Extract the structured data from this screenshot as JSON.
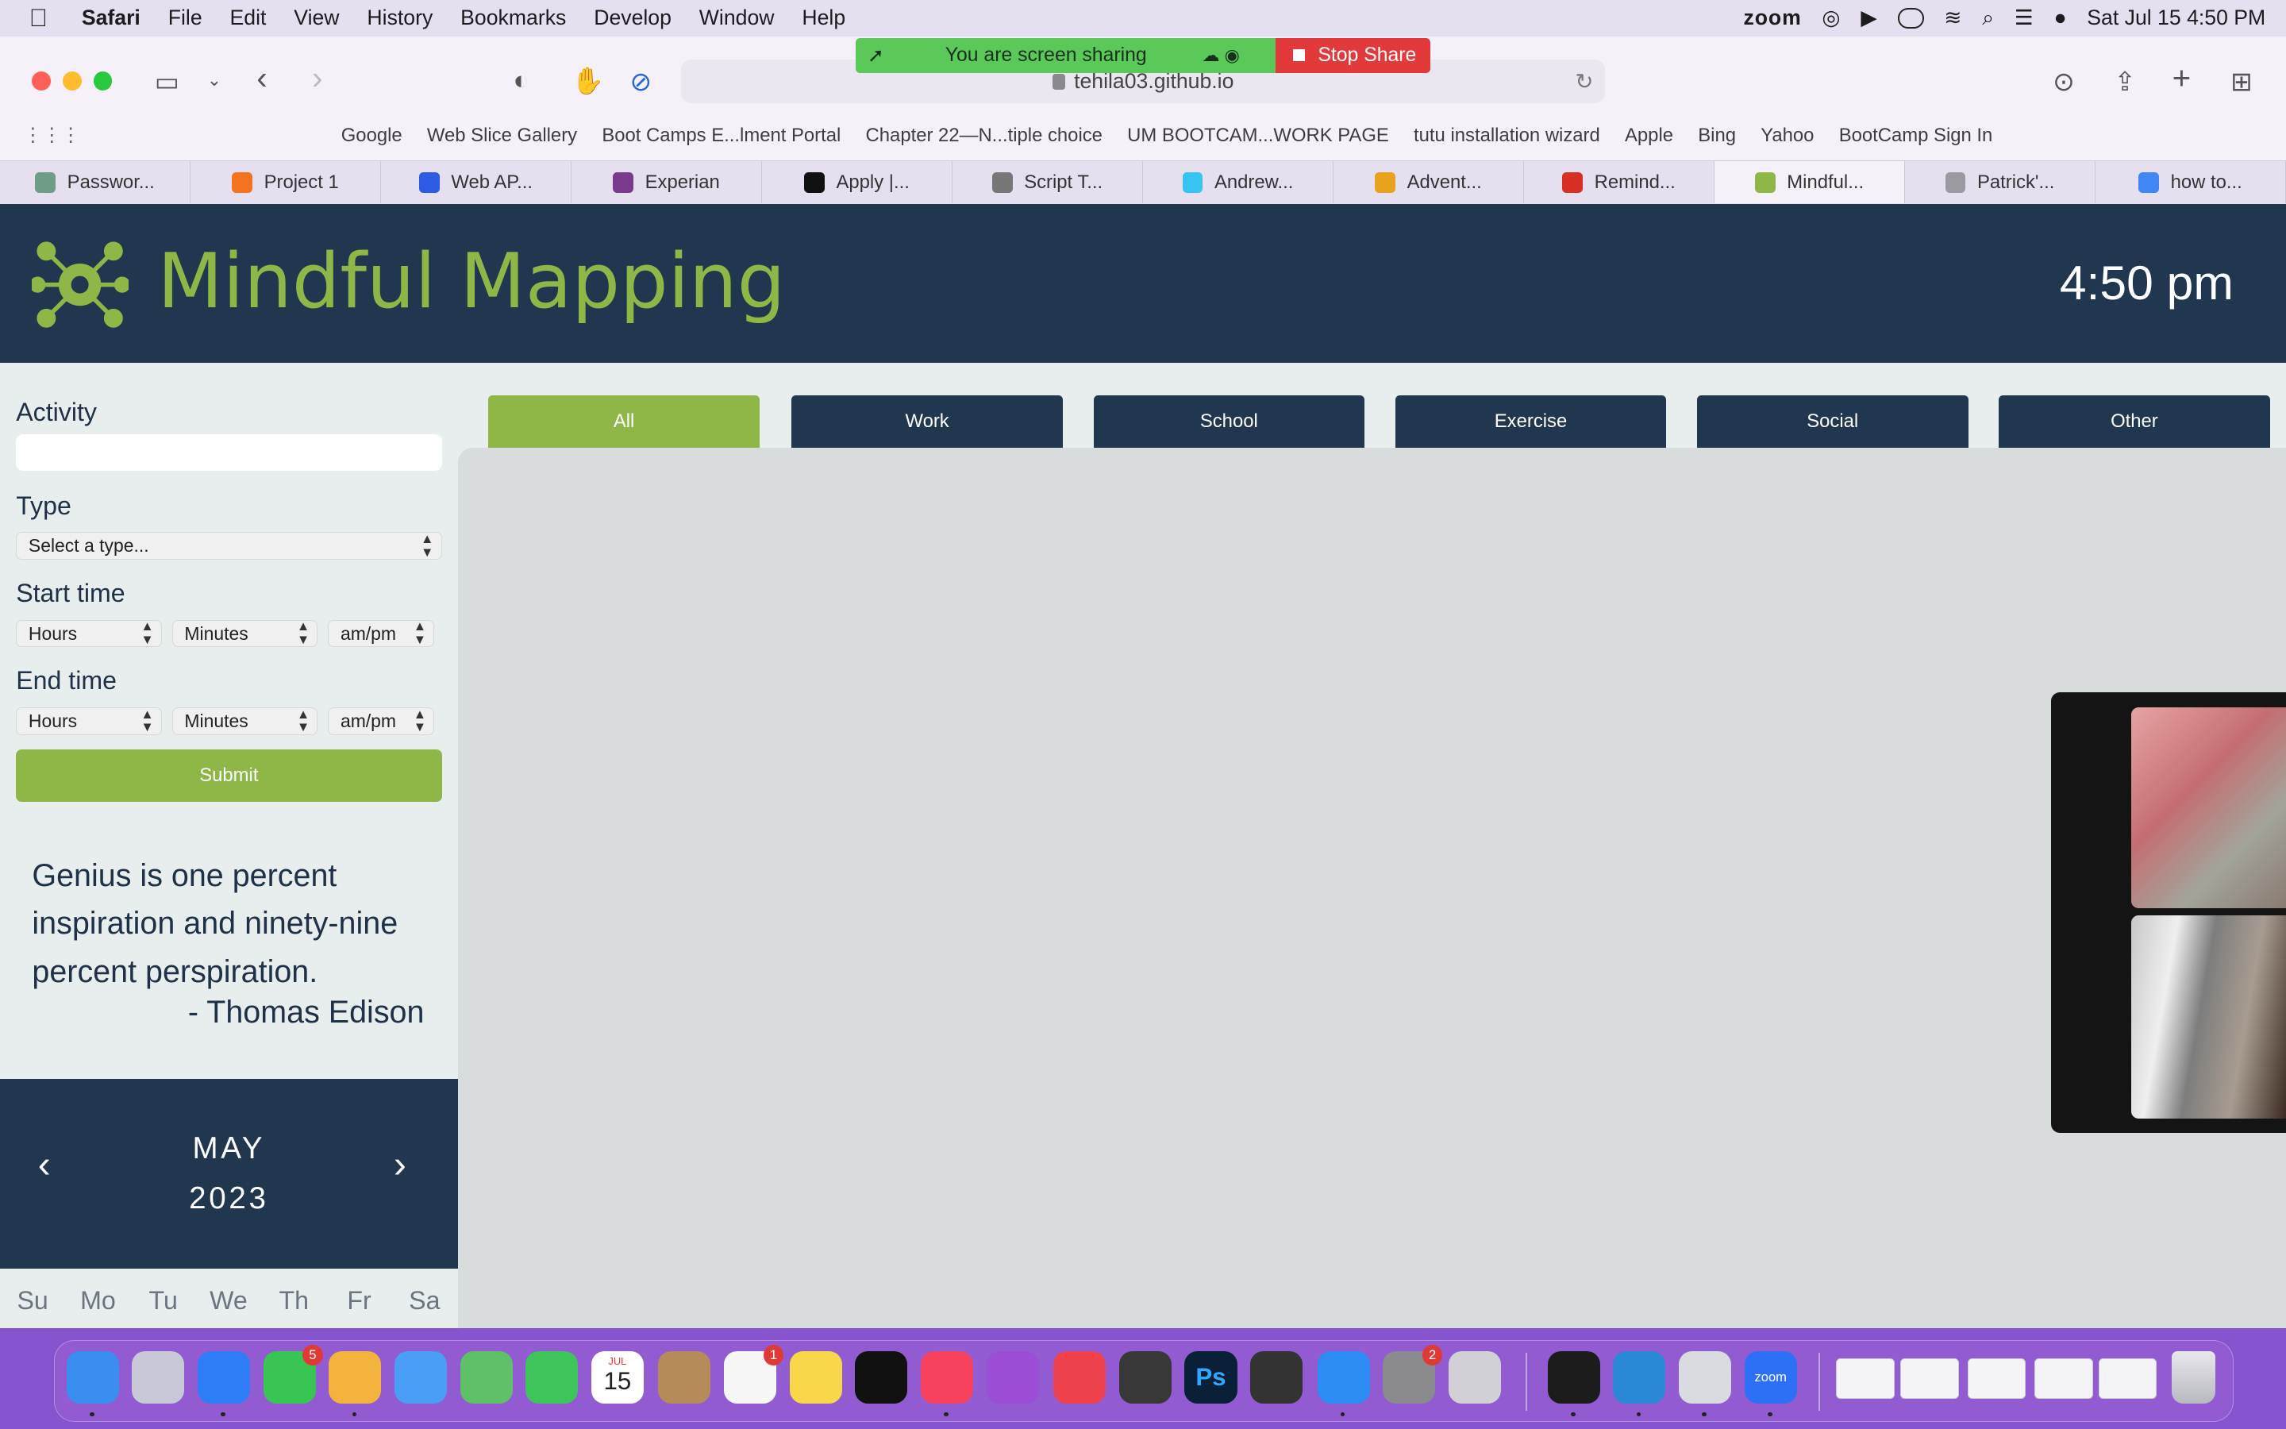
{
  "menubar": {
    "app": "Safari",
    "items": [
      "File",
      "Edit",
      "View",
      "History",
      "Bookmarks",
      "Develop",
      "Window",
      "Help"
    ],
    "zoom": "zoom",
    "datetime": "Sat Jul 15  4:50 PM"
  },
  "share": {
    "status": "You are screen sharing",
    "stop": "Stop Share"
  },
  "browser": {
    "url": "tehila03.github.io",
    "bookmarks": [
      "Google",
      "Web Slice Gallery",
      "Boot Camps E...lment Portal",
      "Chapter 22—N...tiple choice",
      "UM BOOTCAM...WORK PAGE",
      "tutu installation wizard",
      "Apple",
      "Bing",
      "Yahoo",
      "BootCamp Sign In"
    ],
    "tabs": [
      {
        "label": "Passwor...",
        "color": "#6f9d88"
      },
      {
        "label": "Project 1",
        "color": "#f47321"
      },
      {
        "label": "Web AP...",
        "color": "#2d5be3"
      },
      {
        "label": "Experian",
        "color": "#7b3b8c"
      },
      {
        "label": "Apply |...",
        "color": "#111111"
      },
      {
        "label": "Script T...",
        "color": "#777777"
      },
      {
        "label": "Andrew...",
        "color": "#36c5f0"
      },
      {
        "label": "Advent...",
        "color": "#e8a21d"
      },
      {
        "label": "Remind...",
        "color": "#d93025"
      },
      {
        "label": "Mindful...",
        "color": "#8eb748"
      },
      {
        "label": "Patrick'...",
        "color": "#9a9aa0"
      },
      {
        "label": "how to...",
        "color": "#4285f4"
      }
    ]
  },
  "app": {
    "title": "Mindful Mapping",
    "time": "4:50 pm",
    "form": {
      "activity_label": "Activity",
      "type_label": "Type",
      "type_select": "Select a type...",
      "start_label": "Start time",
      "end_label": "End time",
      "hours": "Hours",
      "minutes": "Minutes",
      "ampm": "am/pm",
      "submit": "Submit"
    },
    "quote": "Genius is one percent inspiration and ninety-nine percent perspiration.",
    "author": "- Thomas Edison",
    "calendar": {
      "month": "MAY",
      "year": "2023",
      "prev": "‹",
      "next": "›",
      "days": [
        "Su",
        "Mo",
        "Tu",
        "We",
        "Th",
        "Fr",
        "Sa"
      ]
    },
    "filters": [
      "All",
      "Work",
      "School",
      "Exercise",
      "Social",
      "Other"
    ],
    "active_filter": "All"
  },
  "dock": {
    "apps": [
      {
        "name": "Finder",
        "color": "#3a8ef0",
        "running": true
      },
      {
        "name": "Launchpad",
        "color": "#c8c8d8"
      },
      {
        "name": "Safari",
        "color": "#2e7cf6",
        "running": true
      },
      {
        "name": "Messages",
        "color": "#39c553",
        "badge": "5"
      },
      {
        "name": "Photos",
        "color": "#f4b33c",
        "running": true
      },
      {
        "name": "Mail",
        "color": "#4a9ef5"
      },
      {
        "name": "Maps",
        "color": "#5fc067"
      },
      {
        "name": "FaceTime",
        "color": "#3ec45a"
      },
      {
        "name": "Calendar",
        "color": "#ffffff"
      },
      {
        "name": "Contacts",
        "color": "#b58b5a"
      },
      {
        "name": "Reminders",
        "color": "#f7f7f7",
        "badge": "1"
      },
      {
        "name": "Notes",
        "color": "#f8d84a"
      },
      {
        "name": "TV",
        "color": "#111111"
      },
      {
        "name": "Music",
        "color": "#f5415e",
        "running": true
      },
      {
        "name": "Podcasts",
        "color": "#9b4dd6"
      },
      {
        "name": "News",
        "color": "#f0424c"
      },
      {
        "name": "Final Cut Pro",
        "color": "#383838"
      },
      {
        "name": "Photoshop",
        "color": "#0a1f38"
      },
      {
        "name": "Logic",
        "color": "#333333"
      },
      {
        "name": "App Store",
        "color": "#2d8df4",
        "running": true
      },
      {
        "name": "System Settings",
        "color": "#8a8a8f",
        "badge": "2"
      },
      {
        "name": "Roblox",
        "color": "#d0d0d6"
      },
      {
        "name": "Terminal",
        "color": "#1c1c1c",
        "running": true
      },
      {
        "name": "VS Code",
        "color": "#2a88d6",
        "running": true
      },
      {
        "name": "Preview",
        "color": "#d9dbe0",
        "running": true
      },
      {
        "name": "Zoom",
        "color": "#2d6ff5",
        "running": true
      }
    ],
    "calendar_month": "JUL",
    "calendar_day": "15",
    "zoom_label": "zoom",
    "ps_label": "Ps"
  }
}
